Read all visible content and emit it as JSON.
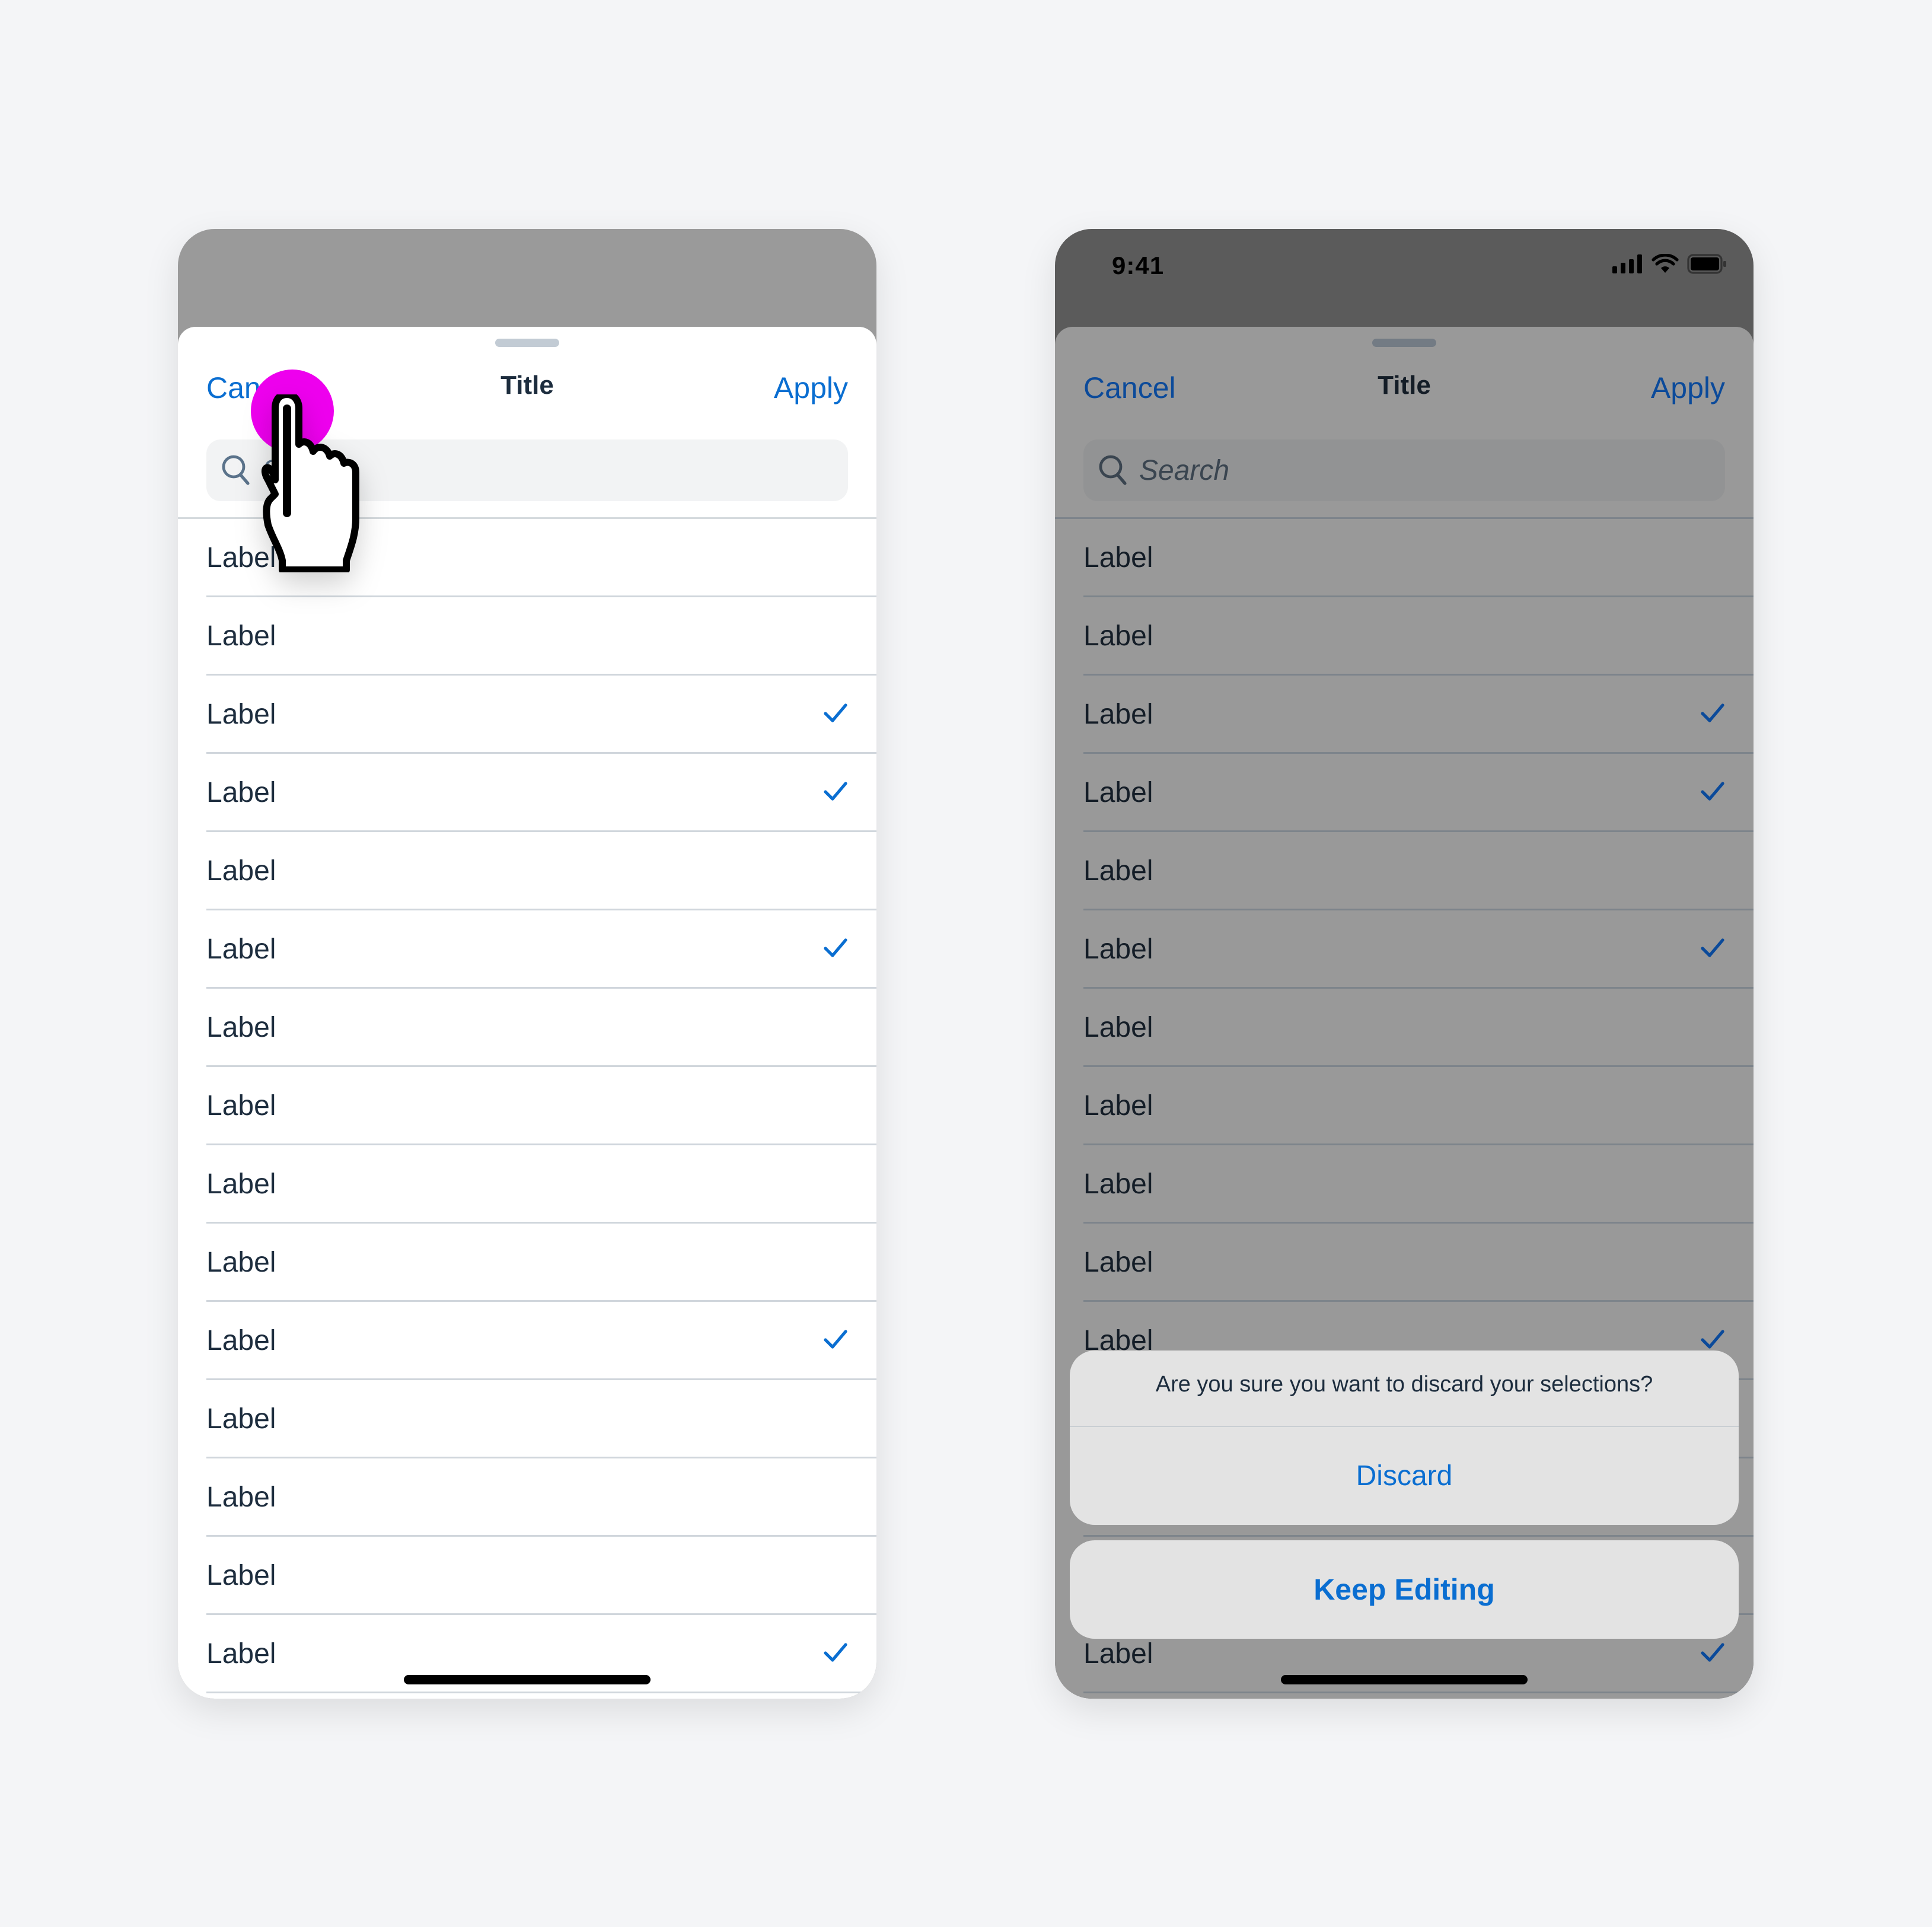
{
  "colors": {
    "background": "#f4f5f7",
    "accent": "#0a6ed1",
    "text": "#1d2d3e",
    "touch_indicator": "#ee00ee"
  },
  "left_phone": {
    "nav": {
      "cancel_label": "Cancel",
      "title": "Title",
      "apply_label": "Apply"
    },
    "search": {
      "placeholder": "Search"
    },
    "rows": [
      {
        "label": "Label",
        "checked": false
      },
      {
        "label": "Label",
        "checked": false
      },
      {
        "label": "Label",
        "checked": true
      },
      {
        "label": "Label",
        "checked": true
      },
      {
        "label": "Label",
        "checked": false
      },
      {
        "label": "Label",
        "checked": true
      },
      {
        "label": "Label",
        "checked": false
      },
      {
        "label": "Label",
        "checked": false
      },
      {
        "label": "Label",
        "checked": false
      },
      {
        "label": "Label",
        "checked": false
      },
      {
        "label": "Label",
        "checked": true
      },
      {
        "label": "Label",
        "checked": false
      },
      {
        "label": "Label",
        "checked": false
      },
      {
        "label": "Label",
        "checked": false
      },
      {
        "label": "Label",
        "checked": true
      }
    ],
    "gesture": "tap-on-cancel"
  },
  "right_phone": {
    "status_bar": {
      "time": "9:41",
      "icons": [
        "cellular-signal-icon",
        "wifi-icon",
        "battery-icon"
      ]
    },
    "nav": {
      "cancel_label": "Cancel",
      "title": "Title",
      "apply_label": "Apply"
    },
    "search": {
      "placeholder": "Search"
    },
    "rows": [
      {
        "label": "Label",
        "checked": false
      },
      {
        "label": "Label",
        "checked": false
      },
      {
        "label": "Label",
        "checked": true
      },
      {
        "label": "Label",
        "checked": true
      },
      {
        "label": "Label",
        "checked": false
      },
      {
        "label": "Label",
        "checked": true
      },
      {
        "label": "Label",
        "checked": false
      },
      {
        "label": "Label",
        "checked": false
      },
      {
        "label": "Label",
        "checked": false
      },
      {
        "label": "Label",
        "checked": false
      },
      {
        "label": "Label",
        "checked": true
      },
      {
        "label": "Label",
        "checked": false
      },
      {
        "label": "Label",
        "checked": false
      },
      {
        "label": "Label",
        "checked": false
      },
      {
        "label": "Label",
        "checked": true
      }
    ],
    "action_sheet": {
      "message": "Are you sure you want to discard your selections?",
      "discard_label": "Discard",
      "keep_editing_label": "Keep Editing"
    }
  }
}
